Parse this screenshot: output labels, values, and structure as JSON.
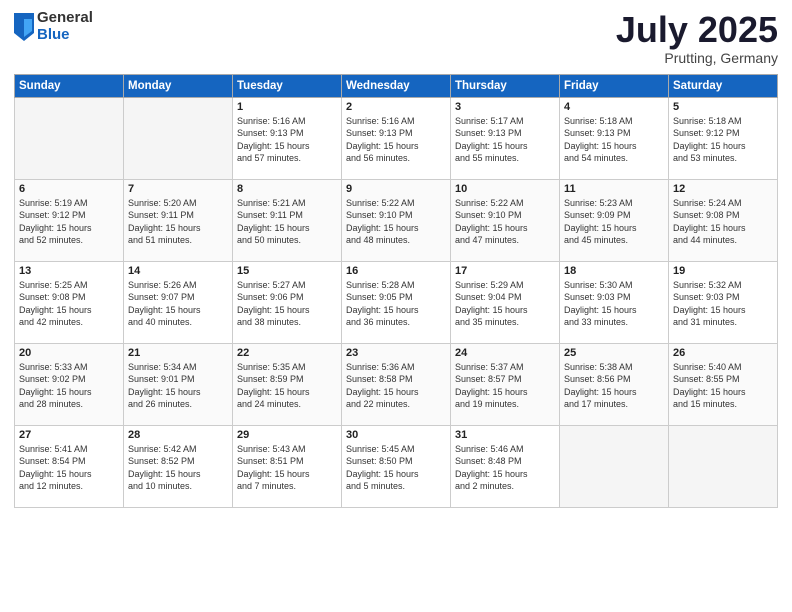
{
  "logo": {
    "general": "General",
    "blue": "Blue"
  },
  "title": "July 2025",
  "location": "Prutting, Germany",
  "weekdays": [
    "Sunday",
    "Monday",
    "Tuesday",
    "Wednesday",
    "Thursday",
    "Friday",
    "Saturday"
  ],
  "weeks": [
    [
      {
        "day": "",
        "info": ""
      },
      {
        "day": "",
        "info": ""
      },
      {
        "day": "1",
        "info": "Sunrise: 5:16 AM\nSunset: 9:13 PM\nDaylight: 15 hours\nand 57 minutes."
      },
      {
        "day": "2",
        "info": "Sunrise: 5:16 AM\nSunset: 9:13 PM\nDaylight: 15 hours\nand 56 minutes."
      },
      {
        "day": "3",
        "info": "Sunrise: 5:17 AM\nSunset: 9:13 PM\nDaylight: 15 hours\nand 55 minutes."
      },
      {
        "day": "4",
        "info": "Sunrise: 5:18 AM\nSunset: 9:13 PM\nDaylight: 15 hours\nand 54 minutes."
      },
      {
        "day": "5",
        "info": "Sunrise: 5:18 AM\nSunset: 9:12 PM\nDaylight: 15 hours\nand 53 minutes."
      }
    ],
    [
      {
        "day": "6",
        "info": "Sunrise: 5:19 AM\nSunset: 9:12 PM\nDaylight: 15 hours\nand 52 minutes."
      },
      {
        "day": "7",
        "info": "Sunrise: 5:20 AM\nSunset: 9:11 PM\nDaylight: 15 hours\nand 51 minutes."
      },
      {
        "day": "8",
        "info": "Sunrise: 5:21 AM\nSunset: 9:11 PM\nDaylight: 15 hours\nand 50 minutes."
      },
      {
        "day": "9",
        "info": "Sunrise: 5:22 AM\nSunset: 9:10 PM\nDaylight: 15 hours\nand 48 minutes."
      },
      {
        "day": "10",
        "info": "Sunrise: 5:22 AM\nSunset: 9:10 PM\nDaylight: 15 hours\nand 47 minutes."
      },
      {
        "day": "11",
        "info": "Sunrise: 5:23 AM\nSunset: 9:09 PM\nDaylight: 15 hours\nand 45 minutes."
      },
      {
        "day": "12",
        "info": "Sunrise: 5:24 AM\nSunset: 9:08 PM\nDaylight: 15 hours\nand 44 minutes."
      }
    ],
    [
      {
        "day": "13",
        "info": "Sunrise: 5:25 AM\nSunset: 9:08 PM\nDaylight: 15 hours\nand 42 minutes."
      },
      {
        "day": "14",
        "info": "Sunrise: 5:26 AM\nSunset: 9:07 PM\nDaylight: 15 hours\nand 40 minutes."
      },
      {
        "day": "15",
        "info": "Sunrise: 5:27 AM\nSunset: 9:06 PM\nDaylight: 15 hours\nand 38 minutes."
      },
      {
        "day": "16",
        "info": "Sunrise: 5:28 AM\nSunset: 9:05 PM\nDaylight: 15 hours\nand 36 minutes."
      },
      {
        "day": "17",
        "info": "Sunrise: 5:29 AM\nSunset: 9:04 PM\nDaylight: 15 hours\nand 35 minutes."
      },
      {
        "day": "18",
        "info": "Sunrise: 5:30 AM\nSunset: 9:03 PM\nDaylight: 15 hours\nand 33 minutes."
      },
      {
        "day": "19",
        "info": "Sunrise: 5:32 AM\nSunset: 9:03 PM\nDaylight: 15 hours\nand 31 minutes."
      }
    ],
    [
      {
        "day": "20",
        "info": "Sunrise: 5:33 AM\nSunset: 9:02 PM\nDaylight: 15 hours\nand 28 minutes."
      },
      {
        "day": "21",
        "info": "Sunrise: 5:34 AM\nSunset: 9:01 PM\nDaylight: 15 hours\nand 26 minutes."
      },
      {
        "day": "22",
        "info": "Sunrise: 5:35 AM\nSunset: 8:59 PM\nDaylight: 15 hours\nand 24 minutes."
      },
      {
        "day": "23",
        "info": "Sunrise: 5:36 AM\nSunset: 8:58 PM\nDaylight: 15 hours\nand 22 minutes."
      },
      {
        "day": "24",
        "info": "Sunrise: 5:37 AM\nSunset: 8:57 PM\nDaylight: 15 hours\nand 19 minutes."
      },
      {
        "day": "25",
        "info": "Sunrise: 5:38 AM\nSunset: 8:56 PM\nDaylight: 15 hours\nand 17 minutes."
      },
      {
        "day": "26",
        "info": "Sunrise: 5:40 AM\nSunset: 8:55 PM\nDaylight: 15 hours\nand 15 minutes."
      }
    ],
    [
      {
        "day": "27",
        "info": "Sunrise: 5:41 AM\nSunset: 8:54 PM\nDaylight: 15 hours\nand 12 minutes."
      },
      {
        "day": "28",
        "info": "Sunrise: 5:42 AM\nSunset: 8:52 PM\nDaylight: 15 hours\nand 10 minutes."
      },
      {
        "day": "29",
        "info": "Sunrise: 5:43 AM\nSunset: 8:51 PM\nDaylight: 15 hours\nand 7 minutes."
      },
      {
        "day": "30",
        "info": "Sunrise: 5:45 AM\nSunset: 8:50 PM\nDaylight: 15 hours\nand 5 minutes."
      },
      {
        "day": "31",
        "info": "Sunrise: 5:46 AM\nSunset: 8:48 PM\nDaylight: 15 hours\nand 2 minutes."
      },
      {
        "day": "",
        "info": ""
      },
      {
        "day": "",
        "info": ""
      }
    ]
  ]
}
